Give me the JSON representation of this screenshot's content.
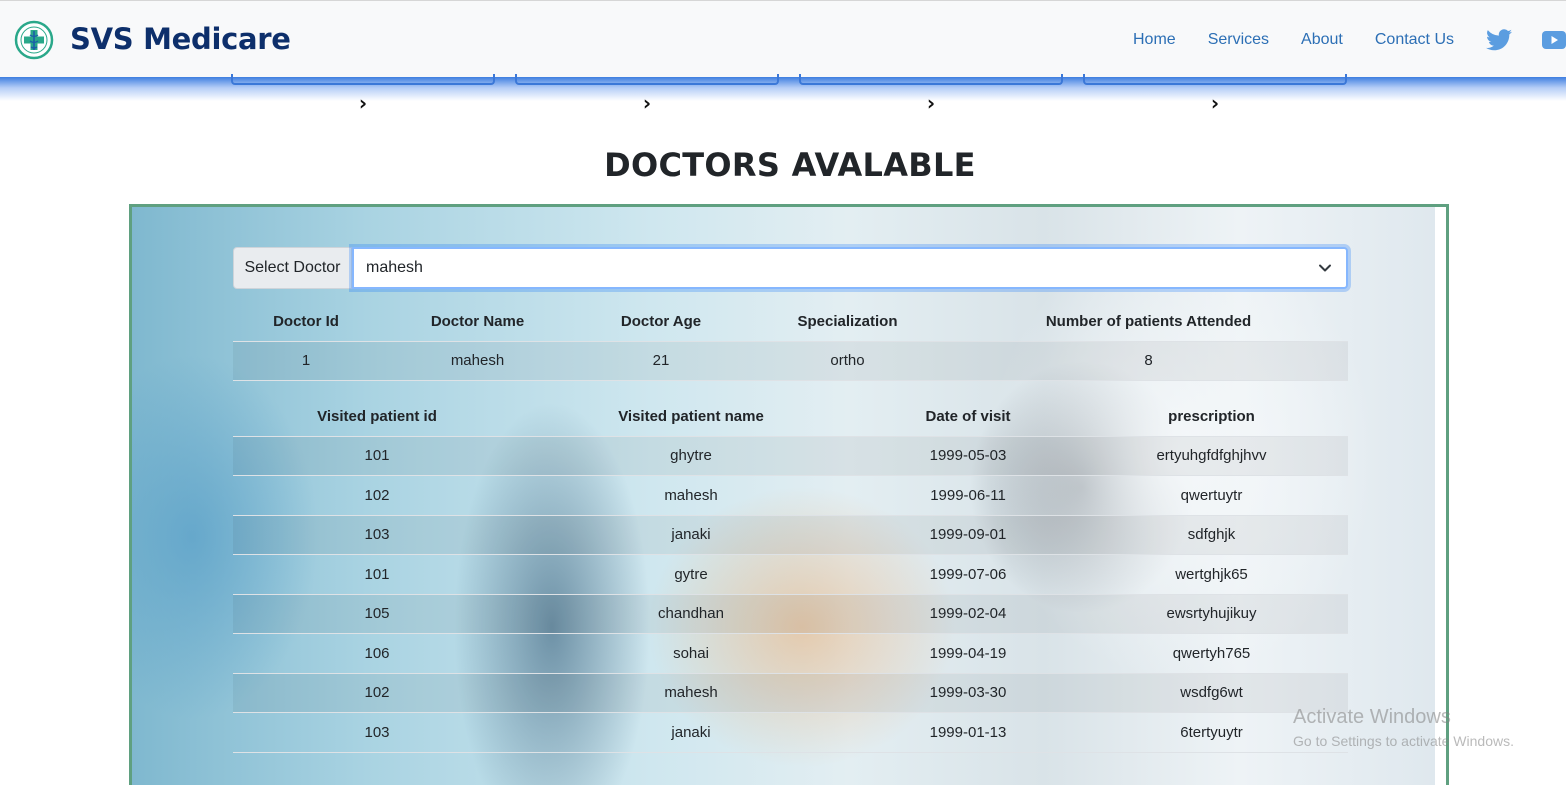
{
  "navbar": {
    "brand": "SVS Medicare",
    "links": [
      "Home",
      "Services",
      "About",
      "Contact Us"
    ],
    "icons": [
      "logo-icon",
      "twitter-icon",
      "youtube-icon"
    ],
    "colors": {
      "brand": "#0d2f6b",
      "link": "#2c6fb5"
    }
  },
  "heading": "DOCTORS AVALABLE",
  "doctor_select": {
    "label": "Select Doctor",
    "value": "mahesh"
  },
  "doctor_table": {
    "headers": [
      "Doctor Id",
      "Doctor Name",
      "Doctor Age",
      "Specialization",
      "Number of patients Attended"
    ],
    "rows": [
      [
        "1",
        "mahesh",
        "21",
        "ortho",
        "8"
      ]
    ]
  },
  "visits_table": {
    "headers": [
      "Visited patient id",
      "Visited patient name",
      "Date of visit",
      "prescription"
    ],
    "rows": [
      [
        "101",
        "ghytre",
        "1999-05-03",
        "ertyuhgfdfghjhvv"
      ],
      [
        "102",
        "mahesh",
        "1999-06-11",
        "qwertuytr"
      ],
      [
        "103",
        "janaki",
        "1999-09-01",
        "sdfghjk"
      ],
      [
        "101",
        "gytre",
        "1999-07-06",
        "wertghjk65"
      ],
      [
        "105",
        "chandhan",
        "1999-02-04",
        "ewsrtyhujikuy"
      ],
      [
        "106",
        "sohai",
        "1999-04-19",
        "qwertyh765"
      ],
      [
        "102",
        "mahesh",
        "1999-03-30",
        "wsdfg6wt"
      ],
      [
        "103",
        "janaki",
        "1999-01-13",
        "6tertyuytr"
      ]
    ]
  },
  "watermark": {
    "title": "Activate Windows",
    "subtitle": "Go to Settings to activate Windows."
  }
}
